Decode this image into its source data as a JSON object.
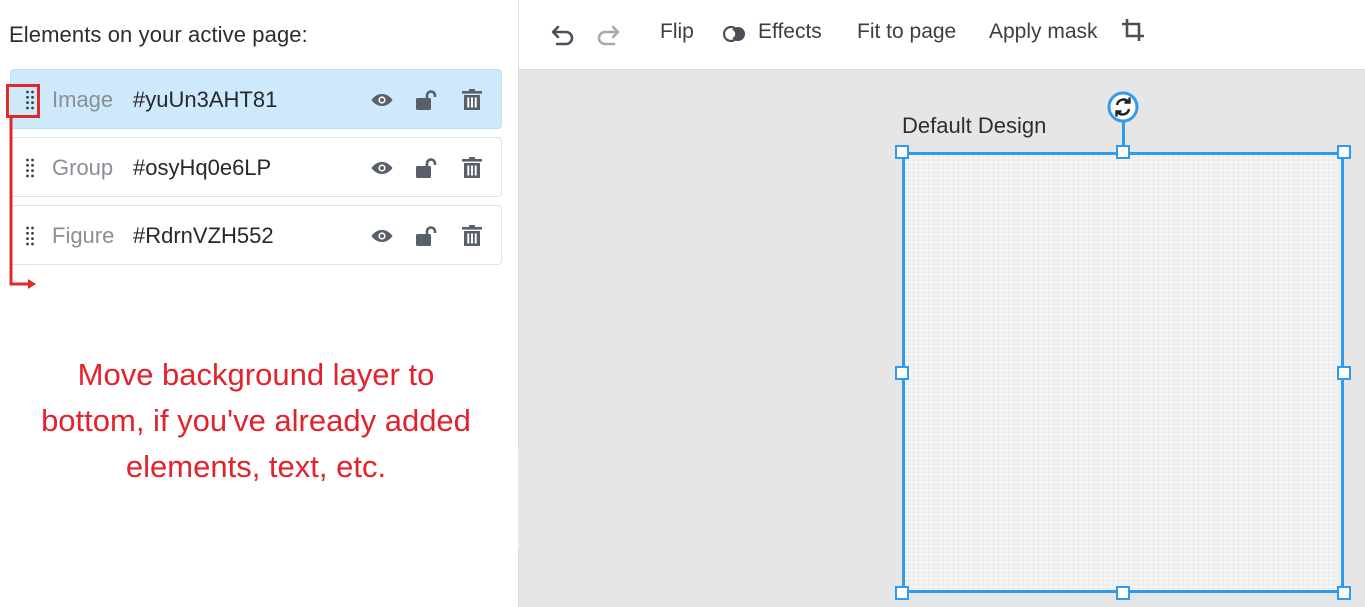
{
  "panel": {
    "title": "Elements on your active page:",
    "layers": [
      {
        "type": "Image",
        "id": "#yuUn3AHT81"
      },
      {
        "type": "Group",
        "id": "#osyHq0e6LP"
      },
      {
        "type": "Figure",
        "id": "#RdrnVZH552"
      }
    ]
  },
  "annotation": {
    "text": "Move background layer to bottom, if you've already added elements, text, etc.",
    "color": "#e3232c"
  },
  "toolbar": {
    "flip": "Flip",
    "effects": "Effects",
    "fit_to_page": "Fit to page",
    "apply_mask": "Apply mask",
    "icons": [
      "undo-icon",
      "redo-icon",
      "effects-icon",
      "crop-icon"
    ]
  },
  "canvas": {
    "design_label": "Default Design"
  },
  "colors": {
    "selection": "#2e9bf0",
    "active_row": "#cde9fb",
    "icon": "#59606a"
  }
}
